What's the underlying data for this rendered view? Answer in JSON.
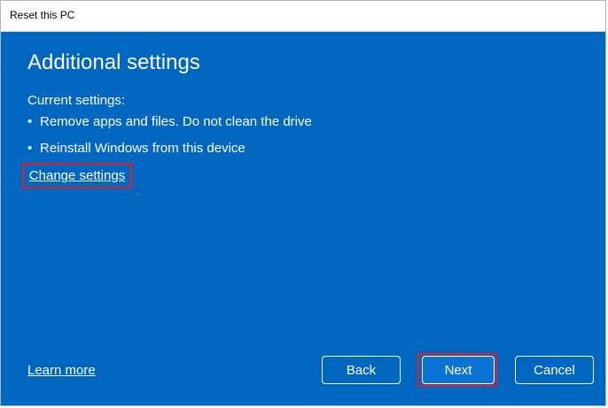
{
  "window": {
    "title": "Reset this PC"
  },
  "main": {
    "heading": "Additional settings",
    "current_label": "Current settings:",
    "settings": [
      "Remove apps and files. Do not clean the drive",
      "Reinstall Windows from this device"
    ],
    "change_settings_link": "Change settings"
  },
  "footer": {
    "learn_more": "Learn more",
    "back_label": "Back",
    "next_label": "Next",
    "cancel_label": "Cancel"
  },
  "colors": {
    "background": "#0067c0",
    "highlight": "#e31b23",
    "text": "#ffffff"
  }
}
